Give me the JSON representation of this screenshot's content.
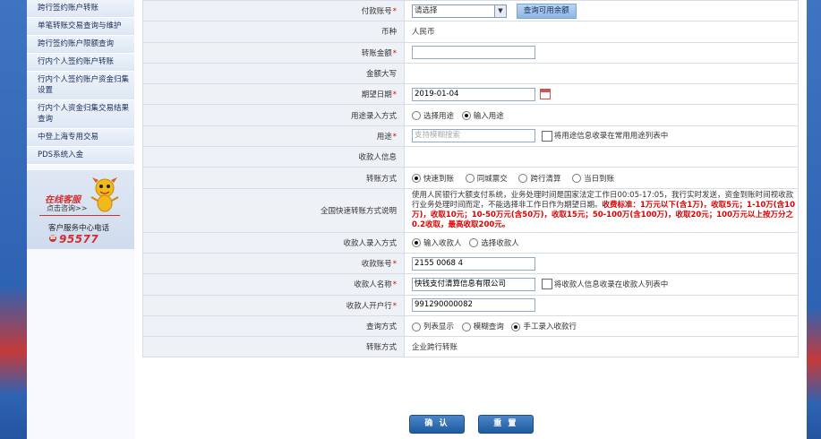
{
  "sidebar": {
    "items": [
      {
        "label": "跨行签约账户转账"
      },
      {
        "label": "单笔转账交易查询与维护"
      },
      {
        "label": "跨行签约账户限额查询"
      },
      {
        "label": "行内个人签约账户转账"
      },
      {
        "label": "行内个人签约账户资金归集设置"
      },
      {
        "label": "行内个人资金归集交易结果查询"
      },
      {
        "label": "中登上海专用交易"
      },
      {
        "label": "PDS系统入金"
      }
    ],
    "customer_service": {
      "online_label": "在线客服",
      "ask_label": "点击咨询>>",
      "center_label": "客户服务中心电话",
      "phone": "95577"
    }
  },
  "form": {
    "pay_account": {
      "label": "付款账号",
      "selected": "请选择",
      "query_button": "查询可用余额"
    },
    "currency": {
      "label": "币种",
      "value": "人民币"
    },
    "amount": {
      "label": "转账金额",
      "value": ""
    },
    "amount_upper": {
      "label": "金额大写",
      "value": ""
    },
    "expected_date": {
      "label": "期望日期",
      "value": "2019-01-04"
    },
    "purpose_entry": {
      "label": "用途录入方式",
      "options": [
        "选择用途",
        "输入用途"
      ],
      "selected_index": 1
    },
    "purpose": {
      "label": "用途",
      "placeholder": "支持模糊搜索",
      "save_label": "将用途信息收录在常用用途列表中"
    },
    "payee_info": {
      "label": "收款人信息"
    },
    "transfer_mode": {
      "label": "转账方式",
      "options": [
        "快速到账",
        "同城票交",
        "跨行清算",
        "当日到账"
      ],
      "selected_index": 0
    },
    "fast_transfer_note": {
      "label": "全国快速转账方式说明",
      "text_normal": "使用人民银行大额支付系统，业务处理时间是国家法定工作日00:05-17:05，我行实时发送，资金到账时间视收款行业务处理时间而定，不能选择非工作日作为期望日期。",
      "text_red": "收费标准：1万元以下(含1万)，收取5元；1-10万(含10万)，收取10元；10-50万元(含50万)，收取15元；50-100万(含100万)，收取20元；100万元以上按万分之0.2收取，最高收取200元。"
    },
    "payee_entry": {
      "label": "收款人录入方式",
      "options": [
        "输入收款人",
        "选择收款人"
      ],
      "selected_index": 0
    },
    "payee_account": {
      "label": "收款账号",
      "value": "2155 0068 4"
    },
    "payee_name": {
      "label": "收款人名称",
      "value": "快钱支付清算信息有限公司",
      "save_label": "将收款人信息收录在收款人列表中"
    },
    "payee_bank": {
      "label": "收款人开户行",
      "value": "991290000082"
    },
    "query_mode": {
      "label": "查询方式",
      "options": [
        "列表显示",
        "模糊查询",
        "手工录入收款行"
      ],
      "selected_index": 2
    },
    "transfer_method": {
      "label": "转账方式",
      "value": "企业跨行转账"
    }
  },
  "actions": {
    "confirm": "确 认",
    "reset": "重 置"
  },
  "colors": {
    "accent": "#2e63b3",
    "required": "#dd0000",
    "button": "#1f5aa0"
  }
}
